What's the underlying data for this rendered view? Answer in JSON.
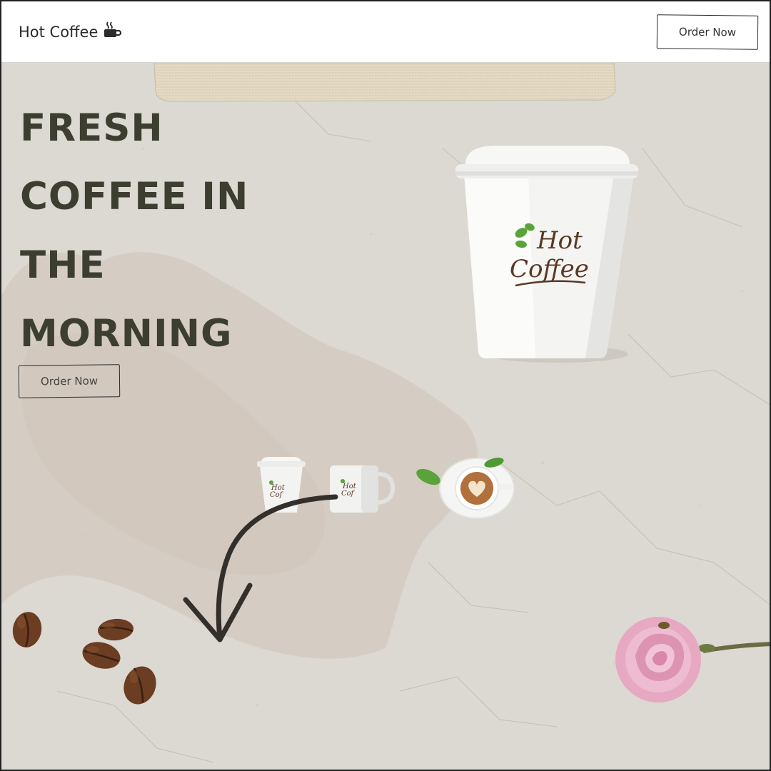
{
  "header": {
    "brand": "Hot Coffee",
    "order_button": "Order Now"
  },
  "hero": {
    "title_lines": [
      "FRESH",
      "COFFEE IN",
      "THE",
      "MORNING"
    ],
    "order_button": "Order Now"
  },
  "cup_logo": {
    "line1": "Hot",
    "line2": "Coffee"
  },
  "icons": {
    "brand": "coffee-cup-icon"
  },
  "colors": {
    "title": "#3c3e2f",
    "background": "#dedad5",
    "header": "#ffffff",
    "logo_brown": "#5a3824",
    "logo_green": "#5aa33a"
  }
}
